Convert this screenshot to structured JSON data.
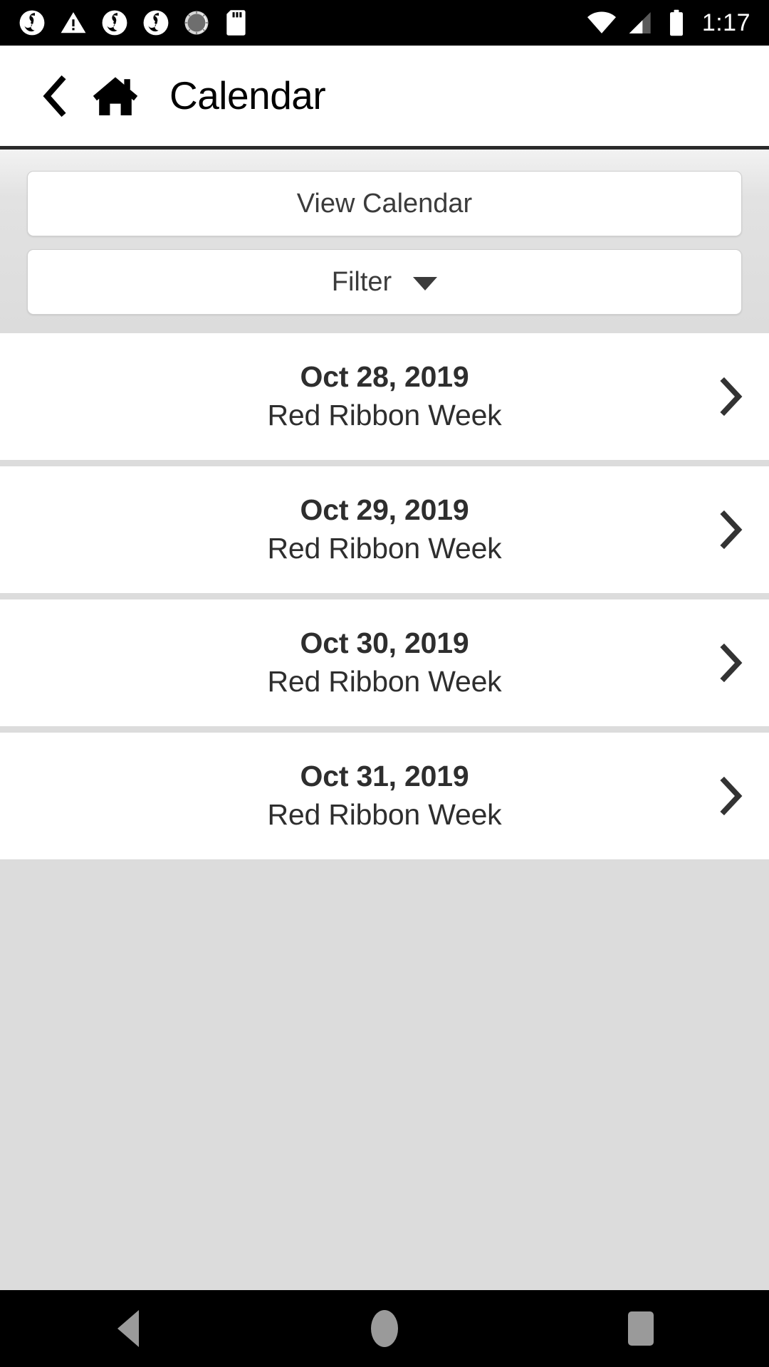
{
  "status_bar": {
    "time": "1:17",
    "left_icons": [
      "sync-icon",
      "warning-triangle-icon",
      "sync-icon",
      "sync-icon",
      "clock-dial-icon",
      "sd-card-icon"
    ],
    "right_icons": [
      "wifi-icon",
      "cellular-signal-icon",
      "battery-icon"
    ],
    "background_color": "#000000",
    "foreground_color": "#ffffff"
  },
  "app_bar": {
    "back_icon": "chevron-left-icon",
    "home_icon": "home-icon",
    "title": "Calendar",
    "background_color": "#ffffff",
    "title_color": "#000000"
  },
  "controls": {
    "view_calendar_label": "View Calendar",
    "filter_label": "Filter",
    "filter_caret_icon": "caret-down-icon"
  },
  "events": [
    {
      "date": "Oct 28, 2019",
      "title": "Red Ribbon Week",
      "chevron_icon": "chevron-right-icon"
    },
    {
      "date": "Oct 29, 2019",
      "title": "Red Ribbon Week",
      "chevron_icon": "chevron-right-icon"
    },
    {
      "date": "Oct 30, 2019",
      "title": "Red Ribbon Week",
      "chevron_icon": "chevron-right-icon"
    },
    {
      "date": "Oct 31, 2019",
      "title": "Red Ribbon Week",
      "chevron_icon": "chevron-right-icon"
    }
  ],
  "nav_bar": {
    "back_icon": "android-back-icon",
    "home_icon": "android-home-icon",
    "recents_icon": "android-recents-icon",
    "background_color": "#000000",
    "icon_color": "#9a9a9a"
  },
  "colors": {
    "page_background": "#dcdcdc",
    "row_background": "#ffffff",
    "text": "#2e2e2e",
    "button_border": "#cfcfcf"
  }
}
